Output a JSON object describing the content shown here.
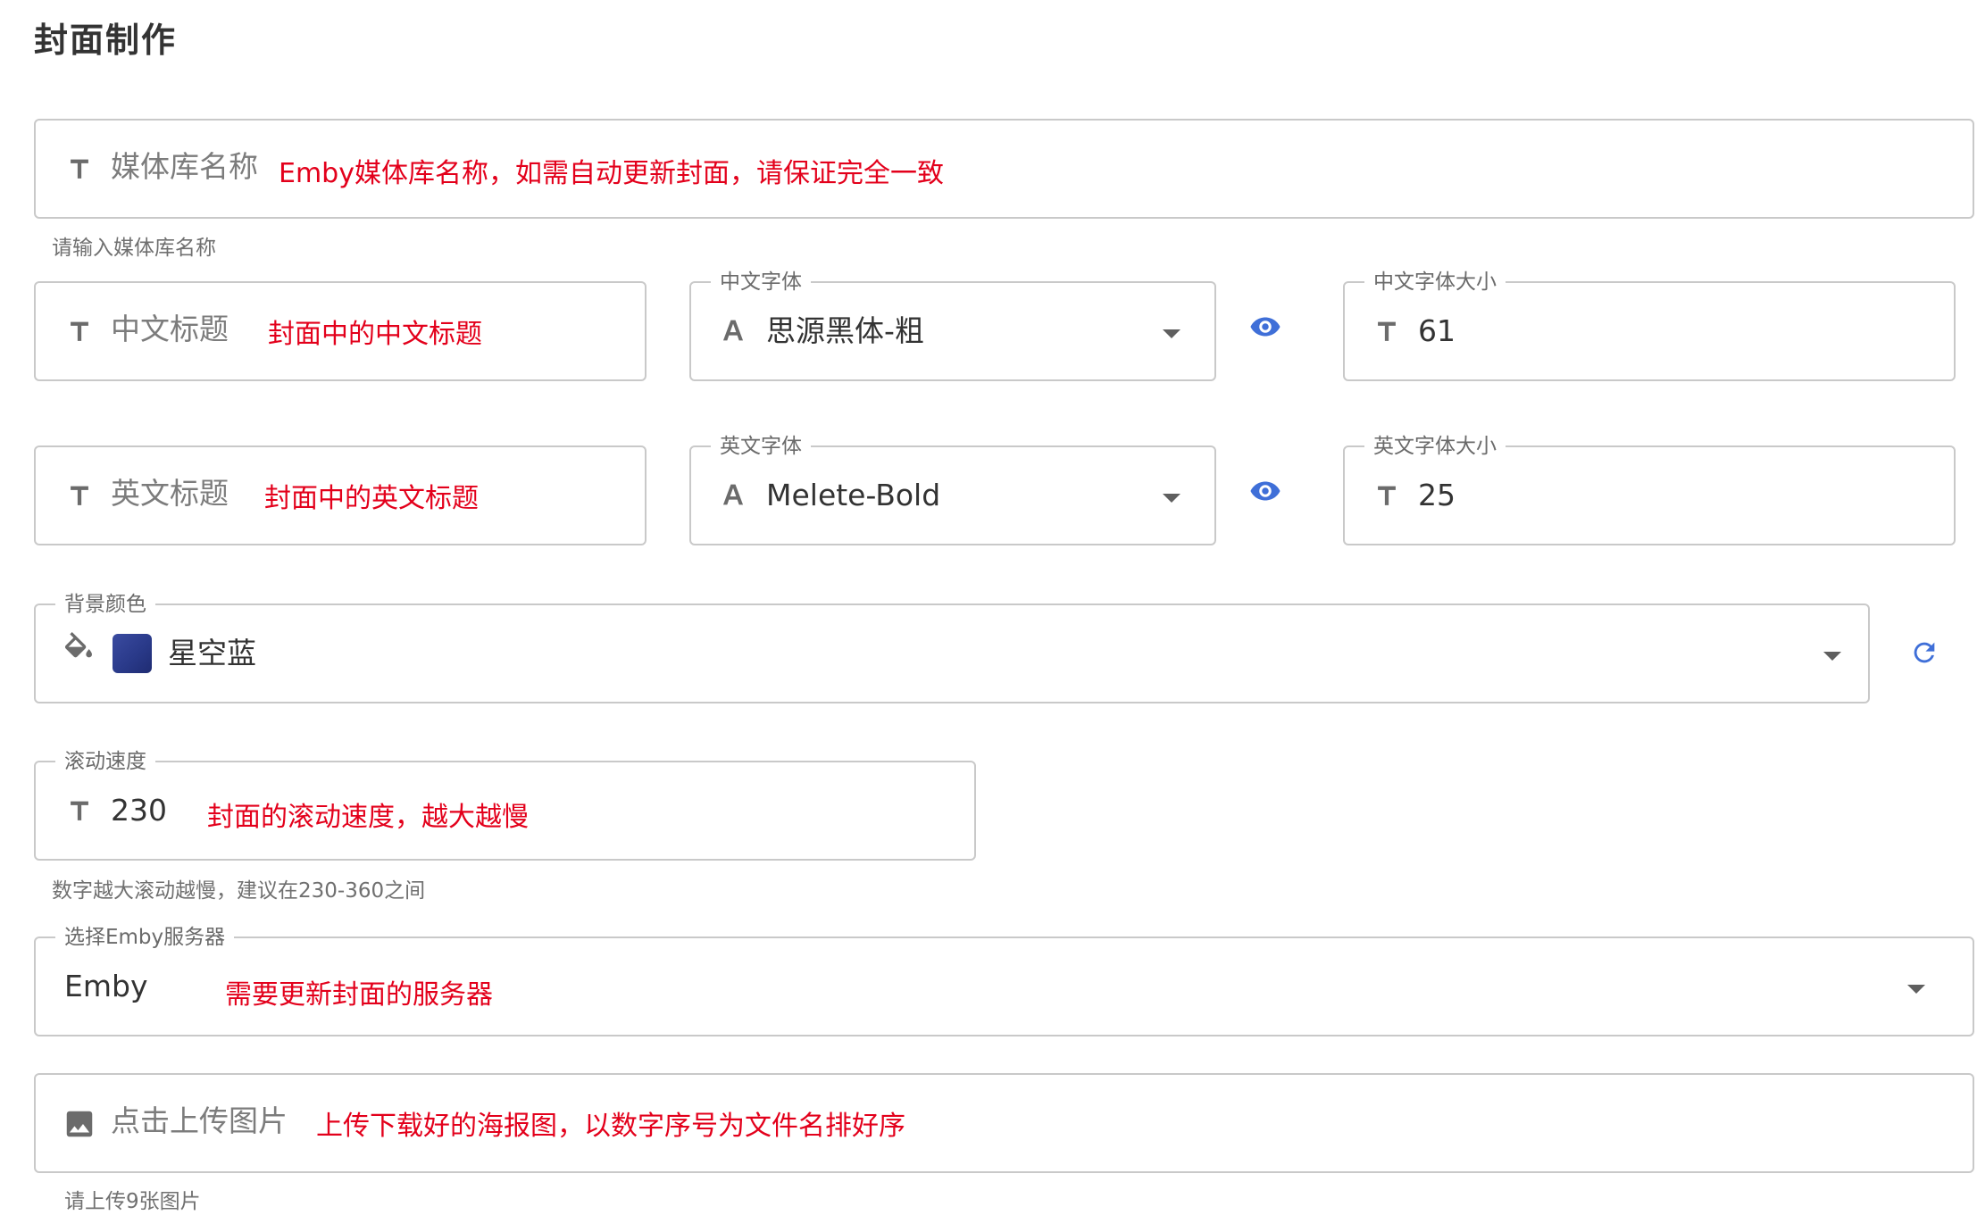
{
  "page": {
    "title": "封面制作"
  },
  "library_name": {
    "placeholder": "媒体库名称",
    "annotation": "Emby媒体库名称，如需自动更新封面，请保证完全一致",
    "hint": "请输入媒体库名称"
  },
  "cn_title": {
    "placeholder": "中文标题",
    "annotation": "封面中的中文标题"
  },
  "cn_font": {
    "label": "中文字体",
    "value": "思源黑体-粗"
  },
  "cn_font_size": {
    "label": "中文字体大小",
    "value": "61"
  },
  "en_title": {
    "placeholder": "英文标题",
    "annotation": "封面中的英文标题"
  },
  "en_font": {
    "label": "英文字体",
    "value": "Melete-Bold"
  },
  "en_font_size": {
    "label": "英文字体大小",
    "value": "25"
  },
  "bg_color": {
    "label": "背景颜色",
    "value": "星空蓝",
    "swatch_color": "#2f3f92"
  },
  "scroll_speed": {
    "label": "滚动速度",
    "value": "230",
    "annotation": "封面的滚动速度，越大越慢",
    "hint": "数字越大滚动越慢，建议在230-360之间"
  },
  "server": {
    "label": "选择Emby服务器",
    "value": "Emby",
    "annotation": "需要更新封面的服务器"
  },
  "upload": {
    "placeholder": "点击上传图片",
    "annotation": "上传下载好的海报图，以数字序号为文件名排好序",
    "hint": "请上传9张图片"
  },
  "colors": {
    "accent": "#3f6fd8",
    "annotation": "#e3001b",
    "border": "#c9c9c9"
  },
  "icons": [
    "text-icon",
    "font-icon",
    "eye-icon",
    "paint-bucket-icon",
    "refresh-icon",
    "image-icon",
    "chevron-down-icon"
  ]
}
